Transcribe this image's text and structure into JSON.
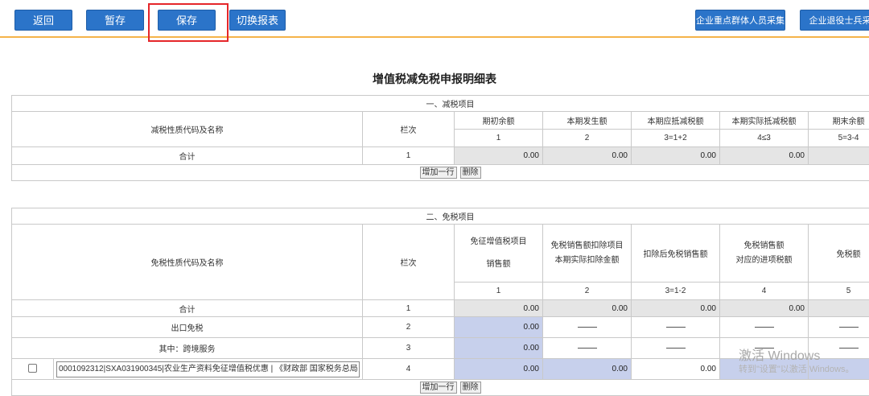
{
  "toolbar": {
    "back": "返回",
    "draft": "暂存",
    "save": "保存",
    "switch_report": "切换报表",
    "key_group": "企业重点群体人员采集",
    "veteran": "企业退役士兵采"
  },
  "page_title": "增值税减免税申报明细表",
  "reduction": {
    "section_title": "一、减税项目",
    "name_header": "减税性质代码及名称",
    "col_header": "栏次",
    "headers": [
      "期初余额",
      "本期发生额",
      "本期应抵减税额",
      "本期实际抵减税额",
      "期末余额"
    ],
    "formulas": [
      "1",
      "2",
      "3=1+2",
      "4≤3",
      "5=3-4"
    ],
    "total_label": "合计",
    "total_row_no": "1",
    "total_values": [
      "0.00",
      "0.00",
      "0.00",
      "0.00"
    ],
    "add_row": "增加一行",
    "delete": "删除"
  },
  "exemption": {
    "section_title": "二、免税项目",
    "name_header": "免税性质代码及名称",
    "col_header": "栏次",
    "headers": [
      [
        "免征增值税项目",
        "销售额"
      ],
      [
        "免税销售额扣除项目",
        "本期实际扣除金额"
      ],
      [
        "扣除后免税销售额",
        ""
      ],
      [
        "免税销售额",
        "对应的进项税额"
      ],
      [
        "免税额",
        ""
      ]
    ],
    "formulas": [
      "1",
      "2",
      "3=1-2",
      "4",
      "5"
    ],
    "rows": [
      {
        "label": "合计",
        "no": "1",
        "values": [
          "0.00",
          "0.00",
          "0.00",
          "0.00"
        ]
      },
      {
        "label": "出口免税",
        "no": "2",
        "values": [
          "0.00"
        ]
      },
      {
        "label": "其中：跨境服务",
        "no": "3",
        "values": [
          "0.00"
        ]
      },
      {
        "label": "0001092312|SXA031900345|农业生产资料免征增值税优惠 | 《财政部 国家税务总局",
        "no": "4",
        "values": [
          "0.00",
          "0.00",
          "0.00"
        ]
      }
    ],
    "add_row": "增加一行",
    "delete": "删除"
  },
  "watermark": {
    "line1": "激活 Windows",
    "line2": "转到\"设置\"以激活 Windows。"
  }
}
